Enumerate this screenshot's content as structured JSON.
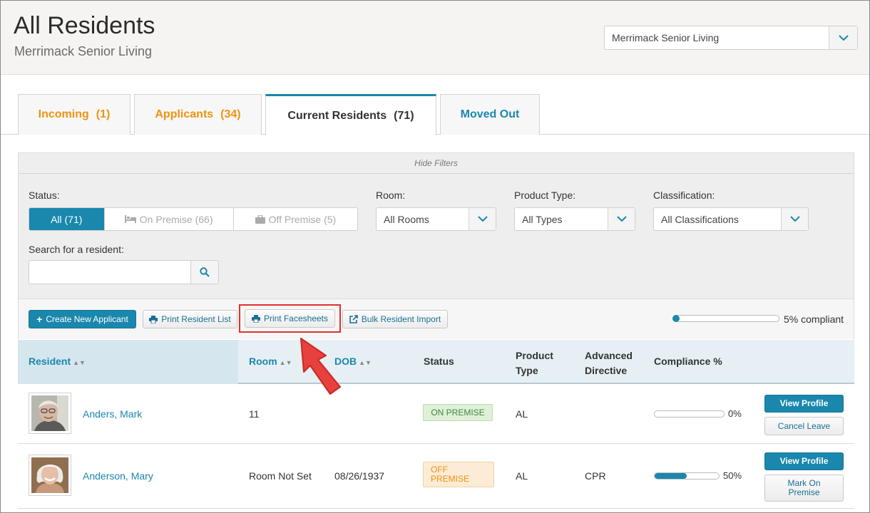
{
  "header": {
    "title": "All Residents",
    "subtitle": "Merrimack Senior Living",
    "community_select": "Merrimack Senior Living"
  },
  "tabs": [
    {
      "label": "Incoming",
      "count": "(1)"
    },
    {
      "label": "Applicants",
      "count": "(34)"
    },
    {
      "label": "Current Residents",
      "count": "(71)"
    },
    {
      "label": "Moved Out",
      "count": ""
    }
  ],
  "filters": {
    "hide_label": "Hide Filters",
    "status_label": "Status:",
    "status_options": [
      "All (71)",
      "On Premise (66)",
      "Off Premise (5)"
    ],
    "room_label": "Room:",
    "room_value": "All Rooms",
    "product_label": "Product Type:",
    "product_value": "All Types",
    "classification_label": "Classification:",
    "classification_value": "All Classifications",
    "search_label": "Search for a resident:",
    "search_value": ""
  },
  "toolbar": {
    "create_label": "Create New Applicant",
    "print_list_label": "Print Resident List",
    "print_facesheets_label": "Print Facesheets",
    "bulk_import_label": "Bulk Resident Import",
    "compliance_text": "5% compliant",
    "compliance_value": 0.05
  },
  "table": {
    "columns": [
      "Resident",
      "Room",
      "DOB",
      "Status",
      "Product Type",
      "Advanced Directive",
      "Compliance %"
    ],
    "rows": [
      {
        "name": "Anders, Mark",
        "room": "11",
        "dob": "",
        "status": "ON PREMISE",
        "product": "AL",
        "directive": "",
        "compliance": "0%",
        "compliance_value": 0,
        "primary_action": "View Profile",
        "secondary_action": "Cancel Leave"
      },
      {
        "name": "Anderson, Mary",
        "room": "Room Not Set",
        "dob": "08/26/1937",
        "status": "OFF PREMISE",
        "product": "AL",
        "directive": "CPR",
        "compliance": "50%",
        "compliance_value": 0.5,
        "primary_action": "View Profile",
        "secondary_action": "Mark On Premise"
      }
    ]
  },
  "colors": {
    "accent": "#1a87ad",
    "orange": "#f0930e",
    "highlight": "#e0312e"
  }
}
